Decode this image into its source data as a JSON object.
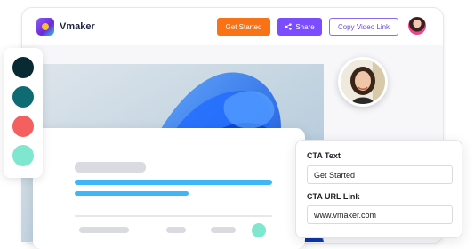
{
  "app": {
    "name": "Vmaker",
    "buttons": {
      "get_started": "Get Started",
      "share": "Share",
      "copy_link": "Copy Video Link"
    }
  },
  "palette": {
    "swatches": [
      "#072a33",
      "#0f6b73",
      "#f45f5f",
      "#7fe6cf"
    ]
  },
  "cta": {
    "text_label": "CTA Text",
    "text_value": "Get Started",
    "url_label": "CTA URL Link",
    "url_value": "www.vmaker.com"
  },
  "colors": {
    "accent_orange": "#f97316",
    "accent_purple": "#7c4dff"
  }
}
